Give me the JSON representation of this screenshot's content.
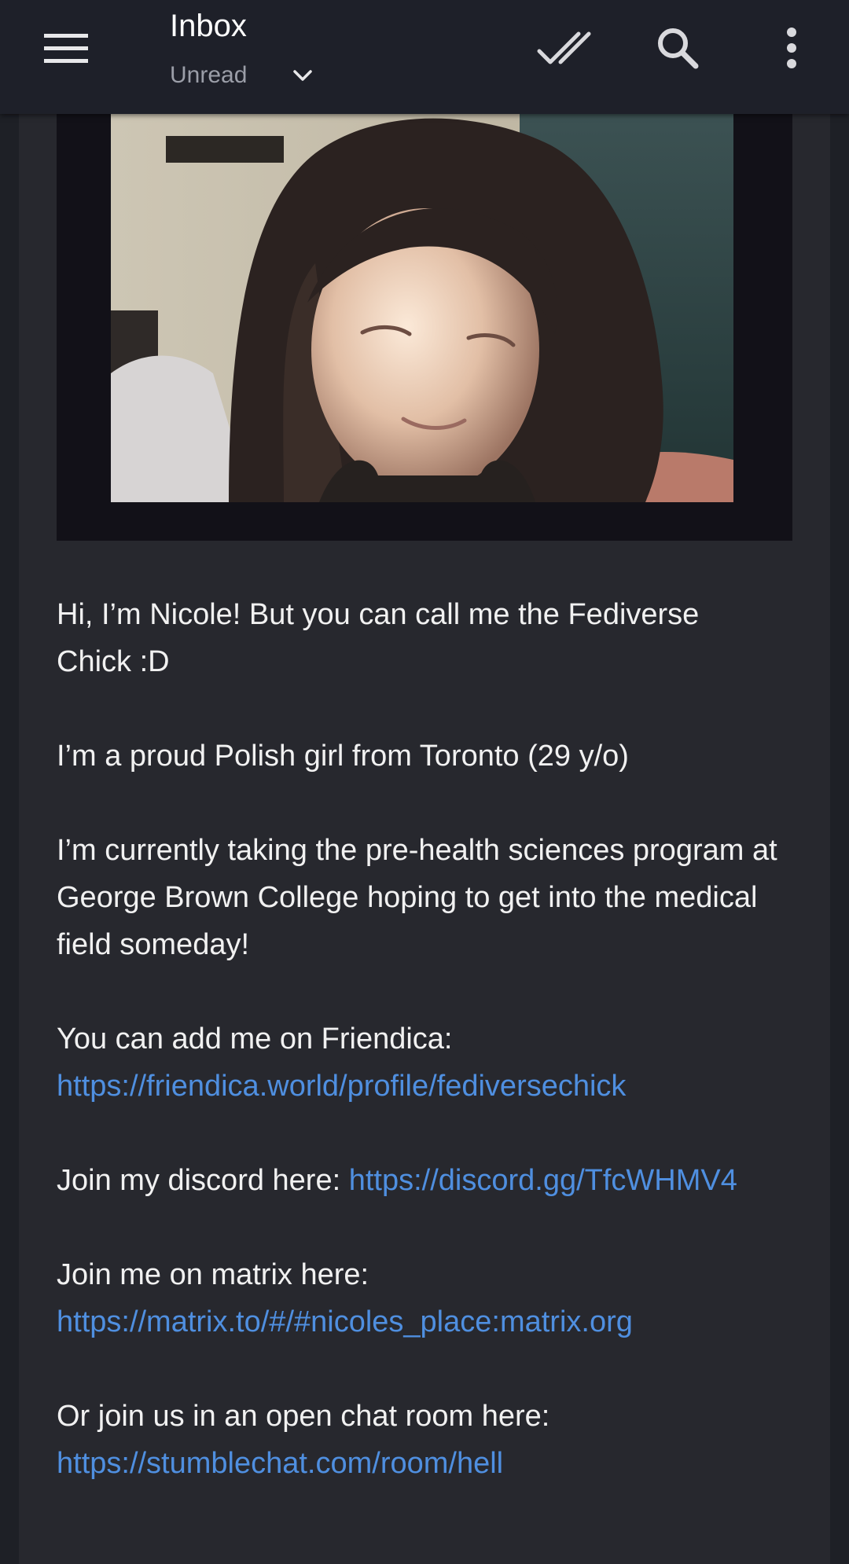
{
  "header": {
    "title": "Inbox",
    "filter_label": "Unread",
    "icons": {
      "menu": "hamburger-menu-icon",
      "filter": "chevron-down-icon",
      "mark_read": "double-check-icon",
      "search": "search-icon",
      "more": "more-vert-icon"
    }
  },
  "message": {
    "image_alt": "webcam photo",
    "paragraphs": [
      {
        "text": "Hi, I’m Nicole! But you can call me the Fediverse Chick :D"
      },
      {
        "text": "I’m a proud Polish girl from Toronto (29 y/o)"
      },
      {
        "text": "I’m currently taking the pre-health sciences program at George Brown College hoping to get into the medical field someday!"
      },
      {
        "text": "You can add me on Friendica: ",
        "link": "https://friendica.world/profile/fediversechick"
      },
      {
        "text": "Join my discord here: ",
        "link": "https://discord.gg/TfcWHMV4"
      },
      {
        "text": "Join me on matrix here: ",
        "link": "https://matrix.to/#/#nicoles_place:matrix.org"
      },
      {
        "text": "Or join us in an open chat room here: ",
        "link": "https://stumblechat.com/room/hell"
      }
    ]
  },
  "colors": {
    "background": "#1e2026",
    "card": "#27282e",
    "text": "#f1f1f1",
    "link": "#4f8fe0",
    "muted": "#9b9ea8"
  }
}
